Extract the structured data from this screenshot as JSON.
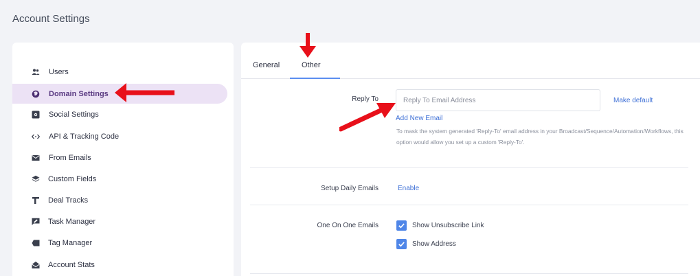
{
  "page": {
    "title": "Account Settings"
  },
  "sidebar": {
    "items": [
      {
        "label": "Users",
        "icon": "users-icon",
        "active": false
      },
      {
        "label": "Domain Settings",
        "icon": "globe-icon",
        "active": true
      },
      {
        "label": "Social Settings",
        "icon": "social-box-icon",
        "active": false
      },
      {
        "label": "API & Tracking Code",
        "icon": "code-arrows-icon",
        "active": false
      },
      {
        "label": "From Emails",
        "icon": "envelope-icon",
        "active": false
      },
      {
        "label": "Custom Fields",
        "icon": "layers-icon",
        "active": false
      },
      {
        "label": "Deal Tracks",
        "icon": "pipe-icon",
        "active": false
      },
      {
        "label": "Task Manager",
        "icon": "edit-chat-icon",
        "active": false
      },
      {
        "label": "Tag Manager",
        "icon": "tag-icon",
        "active": false
      },
      {
        "label": "Account Stats",
        "icon": "envelope-open-icon",
        "active": false
      }
    ]
  },
  "tabs": [
    {
      "label": "General",
      "active": false
    },
    {
      "label": "Other",
      "active": true
    }
  ],
  "reply_to": {
    "label": "Reply To",
    "placeholder": "Reply To Email Address",
    "value": "",
    "make_default": "Make default",
    "add_new": "Add New Email",
    "help": "To mask the system generated 'Reply-To' email address in your Broadcast/Sequence/Automation/Workflows, this option would allow you set up a custom 'Reply-To'."
  },
  "daily_emails": {
    "label": "Setup Daily Emails",
    "action": "Enable"
  },
  "one_on_one": {
    "label": "One On One Emails",
    "options": [
      {
        "label": "Show Unsubscribe Link",
        "checked": true
      },
      {
        "label": "Show Address",
        "checked": true
      }
    ]
  },
  "colors": {
    "accent": "#5b8ef0",
    "link": "#3d6fd6",
    "active_bg": "#ece2f5",
    "annotation": "#e8101a"
  }
}
